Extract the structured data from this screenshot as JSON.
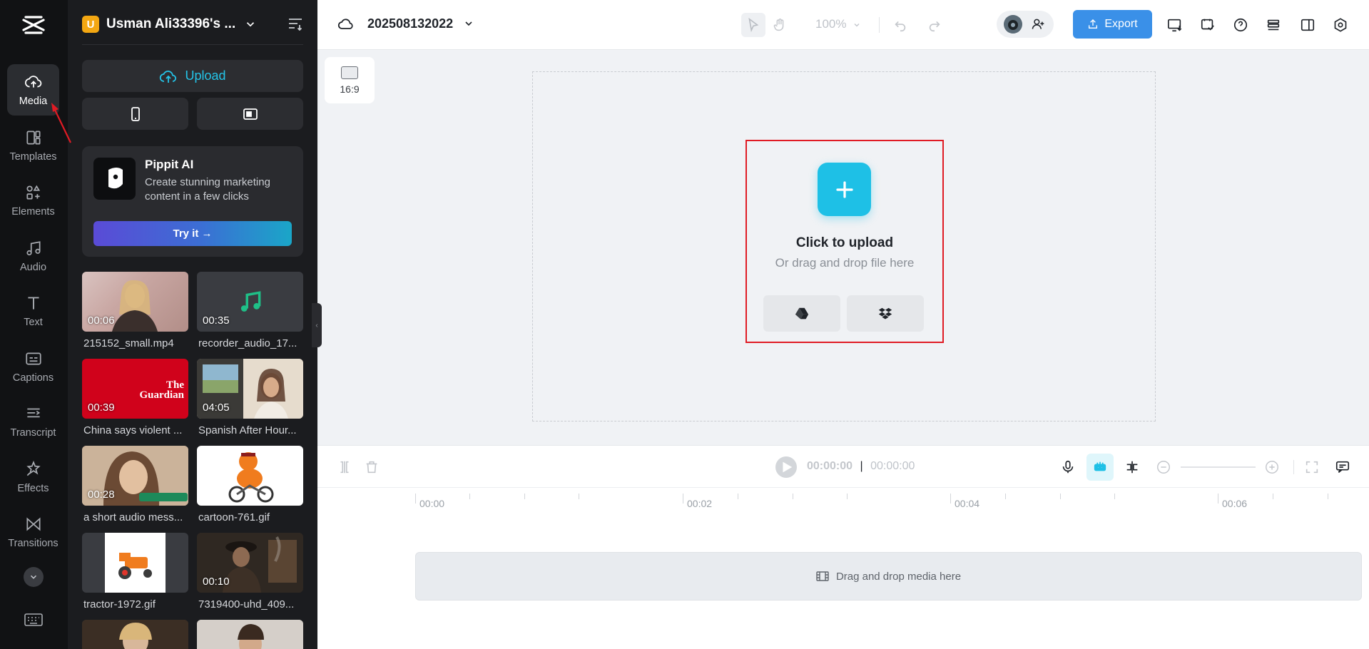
{
  "rail": {
    "items": [
      {
        "label": "Media",
        "icon": "cloud-upload-icon"
      },
      {
        "label": "Templates",
        "icon": "templates-icon"
      },
      {
        "label": "Elements",
        "icon": "elements-icon"
      },
      {
        "label": "Audio",
        "icon": "music-note-icon"
      },
      {
        "label": "Text",
        "icon": "text-icon"
      },
      {
        "label": "Captions",
        "icon": "captions-icon"
      },
      {
        "label": "Transcript",
        "icon": "transcript-icon"
      },
      {
        "label": "Effects",
        "icon": "effects-icon"
      },
      {
        "label": "Transitions",
        "icon": "transitions-icon"
      }
    ]
  },
  "panel": {
    "workspace_badge": "U",
    "workspace_name": "Usman Ali33396's ...",
    "upload_label": "Upload",
    "promo": {
      "title": "Pippit AI",
      "description": "Create stunning marketing content in a few clicks",
      "cta": "Try it →"
    },
    "media": [
      {
        "name": "215152_small.mp4",
        "duration": "00:06"
      },
      {
        "name": "recorder_audio_17...",
        "duration": "00:35"
      },
      {
        "name": "China says violent ...",
        "duration": "00:39",
        "overlay_text": "The Guardian"
      },
      {
        "name": "Spanish After Hour...",
        "duration": "04:05"
      },
      {
        "name": "a short audio mess...",
        "duration": "00:28"
      },
      {
        "name": "cartoon-761.gif",
        "duration": ""
      },
      {
        "name": "tractor-1972.gif",
        "duration": ""
      },
      {
        "name": "7319400-uhd_409...",
        "duration": "00:10"
      }
    ]
  },
  "topbar": {
    "project_name": "202508132022",
    "zoom": "100%",
    "export_label": "Export"
  },
  "canvas": {
    "aspect_ratio": "16:9",
    "upload_title": "Click to upload",
    "upload_subtitle": "Or drag and drop file here"
  },
  "timeline": {
    "current_time": "00:00:00",
    "total_time": "00:00:00",
    "ruler": [
      "00:00",
      "00:02",
      "00:04",
      "00:06"
    ],
    "drop_hint": "Drag and drop media here"
  },
  "colors": {
    "accent": "#1ec0e6",
    "export": "#3a90e8",
    "highlight_border": "#e01b24",
    "rail_bg": "#111214",
    "panel_bg": "#1b1c1f"
  }
}
